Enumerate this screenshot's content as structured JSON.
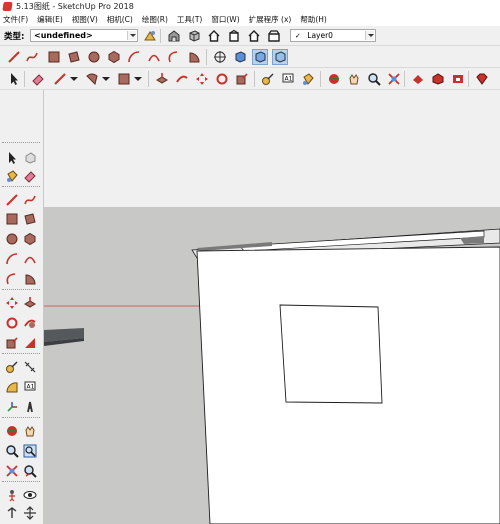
{
  "window": {
    "title": "5.13图纸 - SketchUp Pro 2018"
  },
  "menu": [
    "文件(F)",
    "编辑(E)",
    "视图(V)",
    "相机(C)",
    "绘图(R)",
    "工具(T)",
    "窗口(W)",
    "扩展程序 (x)",
    "帮助(H)"
  ],
  "toolbar": {
    "type_label": "类型:",
    "type_value": "<undefined>",
    "layer_check": "✓",
    "layer_value": "Layer0"
  },
  "colors": {
    "accent_red": "#c8322a",
    "viewport_sky": "#f0f0f0",
    "viewport_ground": "#c8c8c6",
    "axis_red": "#d04040",
    "face_front": "#ffffff",
    "face_side": "#e9e9e9",
    "edge": "#1e1e1e"
  },
  "icons": {
    "row2": [
      "select-icon",
      "eraser-icon",
      "line-icon",
      "arc-icon",
      "rectangle-icon",
      "push-pull-icon",
      "move-icon",
      "rotate-icon",
      "scale-icon",
      "tape-icon",
      "text-icon",
      "paint-icon",
      "orbit-icon",
      "pan-icon",
      "zoom-icon",
      "zoom-extents-icon",
      "warehouse-icon",
      "extension-icon",
      "sandbox-icon",
      "ruby-icon"
    ],
    "left": [
      "select-icon",
      "component-icon",
      "paint-icon",
      "eraser-icon",
      "line-icon",
      "freehand-icon",
      "rectangle-icon",
      "rotated-rectangle-icon",
      "circle-icon",
      "polygon-icon",
      "arc-icon",
      "two-point-arc-icon",
      "three-point-arc-icon",
      "pie-icon",
      "move-icon",
      "push-pull-icon",
      "rotate-icon",
      "follow-me-icon",
      "scale-icon",
      "offset-icon",
      "tape-icon",
      "dimension-icon",
      "protractor-icon",
      "text-icon",
      "axes-icon",
      "3d-text-icon",
      "orbit-icon",
      "pan-icon",
      "zoom-icon",
      "zoom-window-icon",
      "zoom-extents-icon",
      "previous-icon",
      "position-camera-icon",
      "look-around-icon",
      "walk-icon",
      "section-plane-icon"
    ]
  }
}
